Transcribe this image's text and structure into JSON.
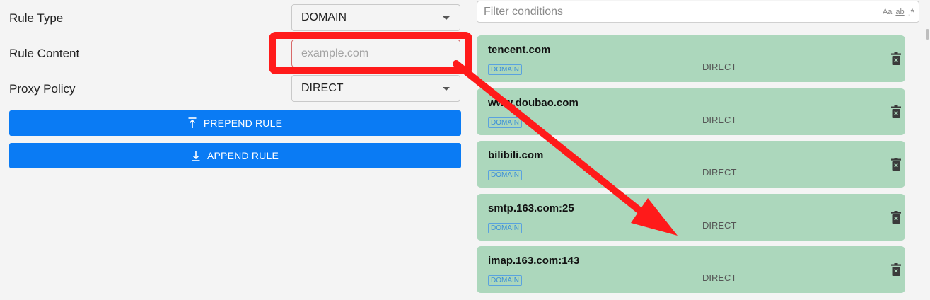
{
  "form": {
    "rule_type_label": "Rule Type",
    "rule_type_value": "DOMAIN",
    "rule_content_label": "Rule Content",
    "rule_content_placeholder": "example.com",
    "proxy_policy_label": "Proxy Policy",
    "proxy_policy_value": "DIRECT",
    "prepend_label": "PREPEND RULE",
    "append_label": "APPEND RULE"
  },
  "filter": {
    "placeholder": "Filter conditions",
    "match_case_label": "Aa",
    "whole_word_label": "ab",
    "regex_label": ".*"
  },
  "rules": [
    {
      "host": "tencent.com",
      "type": "DOMAIN",
      "policy": "DIRECT"
    },
    {
      "host": "www.doubao.com",
      "type": "DOMAIN",
      "policy": "DIRECT"
    },
    {
      "host": "bilibili.com",
      "type": "DOMAIN",
      "policy": "DIRECT"
    },
    {
      "host": "smtp.163.com:25",
      "type": "DOMAIN",
      "policy": "DIRECT"
    },
    {
      "host": "imap.163.com:143",
      "type": "DOMAIN",
      "policy": "DIRECT"
    }
  ],
  "colors": {
    "primary_button": "#0a7bf4",
    "rule_card": "#acd7bc",
    "badge": "#3b8fd8",
    "annotation_red": "#ff1a1a"
  },
  "icons": {
    "prepend": "arrow-up-to-line-icon",
    "append": "arrow-down-to-line-icon",
    "delete": "trash-icon"
  }
}
